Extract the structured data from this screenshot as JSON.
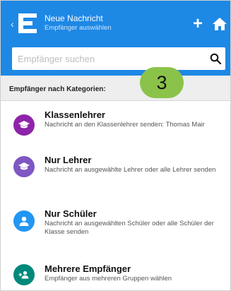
{
  "header": {
    "title": "Neue Nachricht",
    "subtitle": "Empfänger auswählen",
    "logo_letter": "E",
    "plus_label": "+",
    "background": "#1e88e5",
    "icons": [
      "back-chevron-icon",
      "app-logo-icon",
      "plus-icon",
      "home-icon"
    ]
  },
  "search": {
    "placeholder": "Empfänger suchen",
    "value": "",
    "icon": "search-icon"
  },
  "section": {
    "label": "Empfänger nach Kategorien:"
  },
  "step_badge": {
    "label": "3",
    "color": "#8bc34a"
  },
  "items": [
    {
      "title": "Klassenlehrer",
      "description": "Nachricht an den Klassenlehrer senden: Thomas Mair",
      "icon": "graduation-cap-icon",
      "color": "#8e24aa"
    },
    {
      "title": "Nur Lehrer",
      "description": "Nachricht an ausgewählte Lehrer oder alle Lehrer senden",
      "icon": "graduation-cap-icon",
      "color": "#7e57c2"
    },
    {
      "title": "Nur Schüler",
      "description": "Nachricht an ausgewählten Schüler oder alle Schüler der Klasse senden",
      "icon": "person-icon",
      "color": "#2196f3"
    },
    {
      "title": "Mehrere Empfänger",
      "description": "Empfänger aus mehreren Gruppen wählen",
      "icon": "group-add-icon",
      "color": "#00897b"
    }
  ]
}
